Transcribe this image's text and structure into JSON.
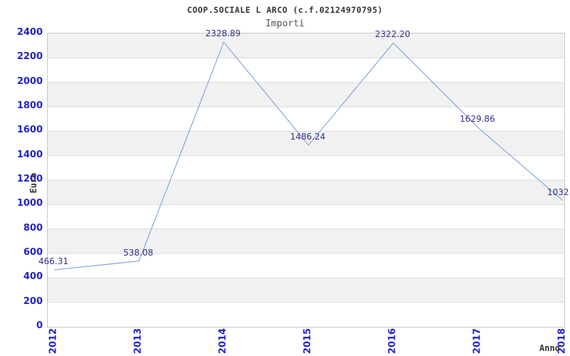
{
  "header": {
    "title": "COOP.SOCIALE L ARCO (c.f.02124970795)",
    "subtitle": "Importi"
  },
  "chart_data": {
    "type": "line",
    "title": "COOP.SOCIALE L ARCO (c.f.02124970795)",
    "subtitle": "Importi",
    "xlabel": "Anno",
    "ylabel": "Euro",
    "categories": [
      "2012",
      "2013",
      "2014",
      "2015",
      "2016",
      "2017",
      "2018"
    ],
    "values": [
      466.31,
      538.08,
      2328.89,
      1486.24,
      2322.2,
      1629.86,
      1032.0
    ],
    "point_labels": [
      "466.31",
      "538.08",
      "2328.89",
      "1486.24",
      "2322.20",
      "1629.86",
      "1032.0"
    ],
    "ylim": [
      0,
      2400
    ],
    "ytick_step": 200,
    "grid": "horizontal-alternating-bands",
    "legend": "none",
    "colors": {
      "line": "#6f9bd6",
      "tick_label": "#2323cd",
      "point_label": "#32328c",
      "band_gray": "#f1f1f1",
      "grid_line": "#dcdcdc",
      "plot_border": "#c9c9c9",
      "title": "#333333",
      "subtitle": "#555555",
      "axis_label": "#333333"
    }
  }
}
